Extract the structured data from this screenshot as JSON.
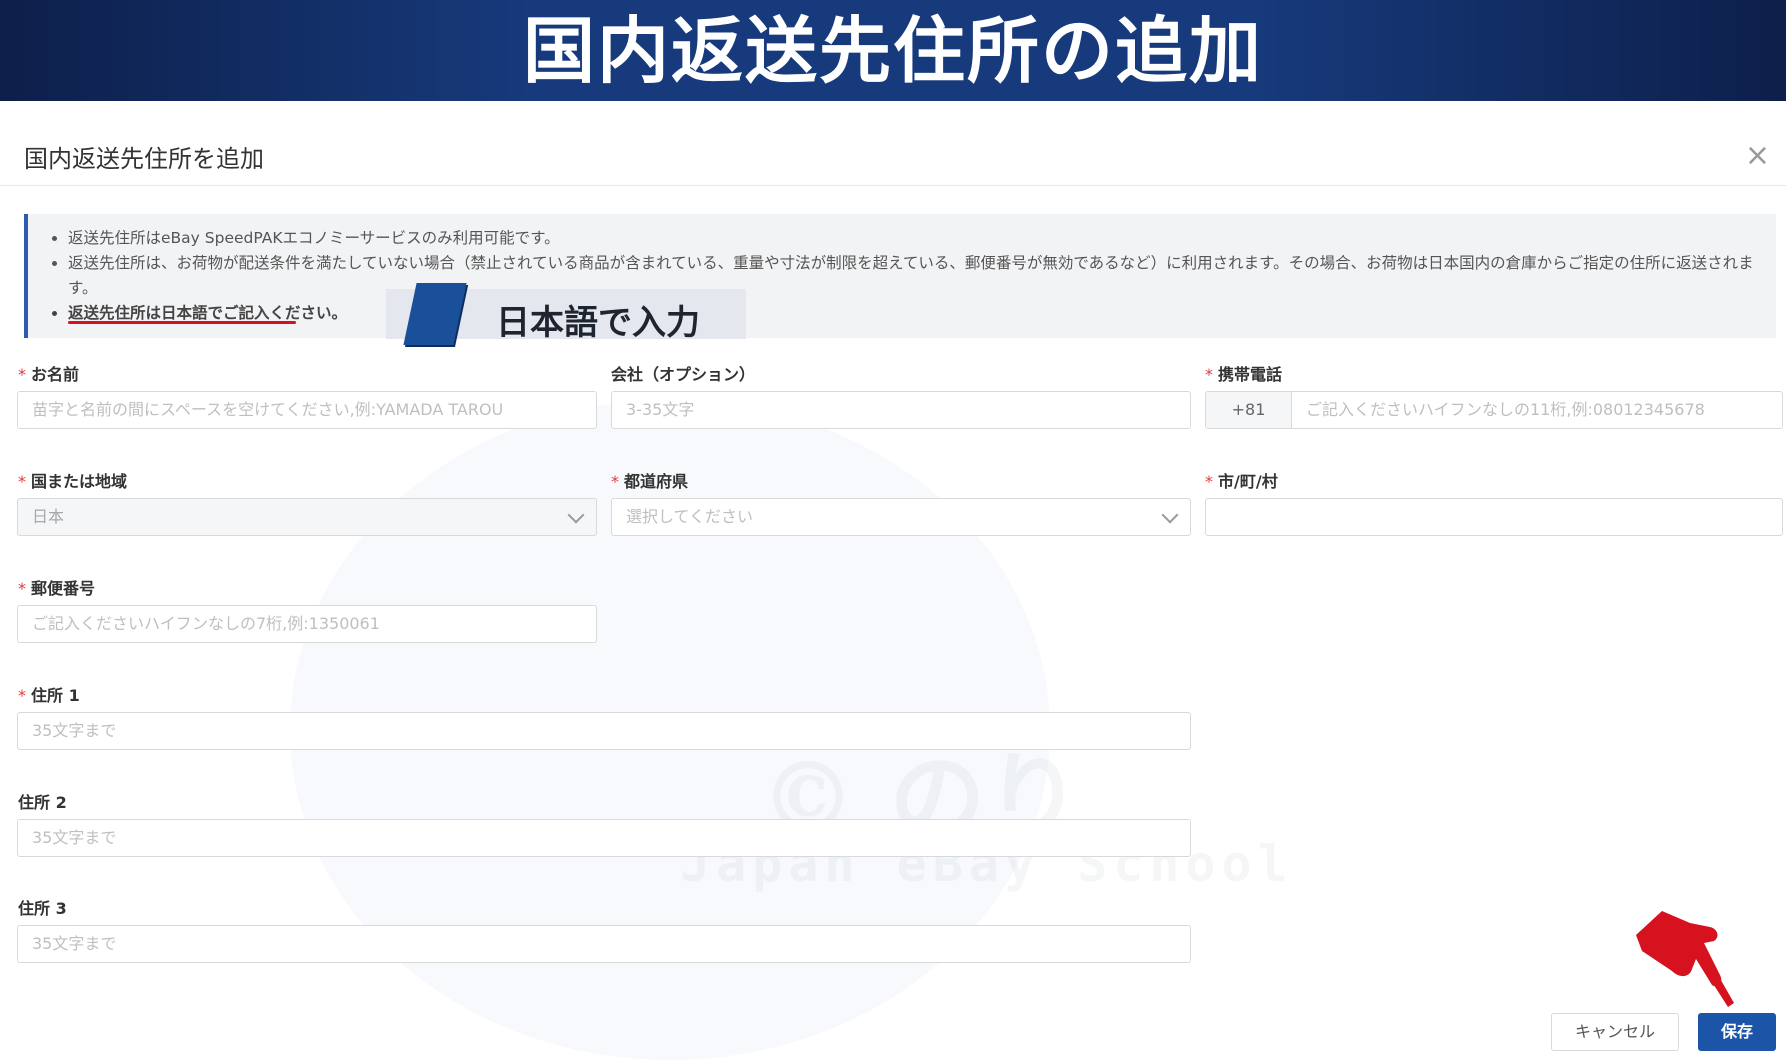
{
  "banner": {
    "title": "国内返送先住所の追加"
  },
  "dialog": {
    "title": "国内返送先住所を追加",
    "close_label": "×"
  },
  "notice": {
    "items": [
      "返送先住所はeBay SpeedPAKエコノミーサービスのみ利用可能です。",
      "返送先住所は、お荷物が配送条件を満たしていない場合（禁止されている商品が含まれている、重量や寸法が制限を超えている、郵便番号が無効であるなど）に利用されます。その場合、お荷物は日本国内の倉庫からご指定の住所に返送されます。",
      "返送先住所は日本語でご記入ください。"
    ]
  },
  "callout": {
    "text": "日本語で入力"
  },
  "form": {
    "required_mark": "*",
    "name": {
      "label": "お名前",
      "placeholder": "苗字と名前の間にスペースを空けてください,例:YAMADA TAROU"
    },
    "company": {
      "label": "会社（オプション）",
      "placeholder": "3-35文字"
    },
    "phone": {
      "label": "携帯電話",
      "prefix": "+81",
      "placeholder": "ご記入くださいハイフンなしの11桁,例:08012345678"
    },
    "country": {
      "label": "国または地域",
      "value": "日本"
    },
    "prefecture": {
      "label": "都道府県",
      "placeholder": "選択してください"
    },
    "city": {
      "label": "市/町/村",
      "value": ""
    },
    "postal": {
      "label": "郵便番号",
      "placeholder": "ご記入くださいハイフンなしの7桁,例:1350061"
    },
    "address1": {
      "label": "住所 1",
      "placeholder": "35文字まで"
    },
    "address2": {
      "label": "住所 2",
      "placeholder": "35文字まで"
    },
    "address3": {
      "label": "住所 3",
      "placeholder": "35文字まで"
    }
  },
  "buttons": {
    "cancel": "キャンセル",
    "save": "保存"
  },
  "watermark": {
    "text": "© のり",
    "sub": "Japan eBay School"
  },
  "colors": {
    "banner": "#173a7c",
    "primary": "#1c54a8",
    "required": "#e4393c",
    "emphasis_underline": "#d6121e",
    "pointer_hand": "#d6121e"
  },
  "icons": {
    "close": "close-icon",
    "dropdown": "chevron-down-icon",
    "pointer": "pointing-hand-icon"
  }
}
